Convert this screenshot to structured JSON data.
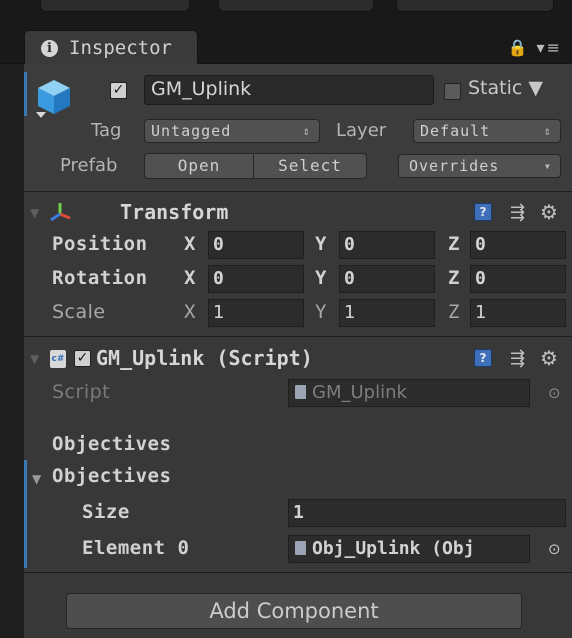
{
  "window": {
    "tab_label": "Inspector",
    "tab_menu_glyphs": "🔒 ▾≡"
  },
  "gameobject": {
    "active_checked": true,
    "name": "GM_Uplink",
    "static_label": "Static",
    "tag_label": "Tag",
    "tag_value": "Untagged",
    "layer_label": "Layer",
    "layer_value": "Default",
    "prefab_label": "Prefab",
    "prefab_open": "Open",
    "prefab_select": "Select",
    "prefab_overrides": "Overrides"
  },
  "transform": {
    "title": "Transform",
    "rows": [
      {
        "label": "Position",
        "x": "0",
        "y": "0",
        "z": "0"
      },
      {
        "label": "Rotation",
        "x": "0",
        "y": "0",
        "z": "0"
      },
      {
        "label": "Scale",
        "x": "1",
        "y": "1",
        "z": "1"
      }
    ],
    "axis_x": "X",
    "axis_y": "Y",
    "axis_z": "Z"
  },
  "script_component": {
    "title": "GM_Uplink (Script)",
    "enabled": true,
    "script_label": "Script",
    "script_value": "GM_Uplink",
    "section_header": "Objectives",
    "foldout_label": "Objectives",
    "size_label": "Size",
    "size_value": "1",
    "element0_label": "Element 0",
    "element0_value": "Obj_Uplink (Obj"
  },
  "add_component_label": "Add Component",
  "colors": {
    "panel_bg": "#383838",
    "accent_blue": "#3a78b5",
    "help_icon": "#3f6fb8"
  }
}
